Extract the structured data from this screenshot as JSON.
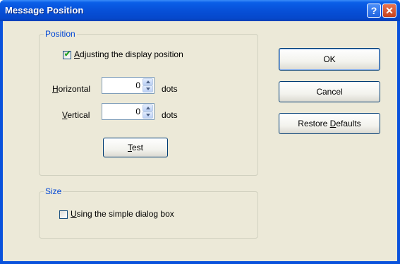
{
  "window": {
    "title": "Message Position",
    "help_glyph": "?",
    "close_glyph": "✕"
  },
  "position_group": {
    "legend": "Position",
    "adjust_checkbox": {
      "checked": true,
      "accel": "A",
      "rest": "djusting the display position"
    },
    "horizontal": {
      "accel": "H",
      "rest": "orizontal",
      "value": "0",
      "unit": "dots"
    },
    "vertical": {
      "accel": "V",
      "rest": "ertical",
      "value": "0",
      "unit": "dots"
    },
    "test_button": {
      "accel": "T",
      "rest": "est"
    }
  },
  "size_group": {
    "legend": "Size",
    "simple_checkbox": {
      "checked": false,
      "accel": "U",
      "rest": "sing the simple dialog box"
    }
  },
  "buttons": {
    "ok": "OK",
    "cancel": "Cancel",
    "restore_pre": "Restore ",
    "restore_accel": "D",
    "restore_rest": "efaults"
  },
  "colors": {
    "titlebar": "#0a52dc",
    "dialog_bg": "#ece9d8",
    "legend_text": "#0046d5",
    "checkmark": "#21a121"
  },
  "icons": {
    "help": "question-mark-icon",
    "close": "close-x-icon",
    "check": "checkmark-icon"
  }
}
